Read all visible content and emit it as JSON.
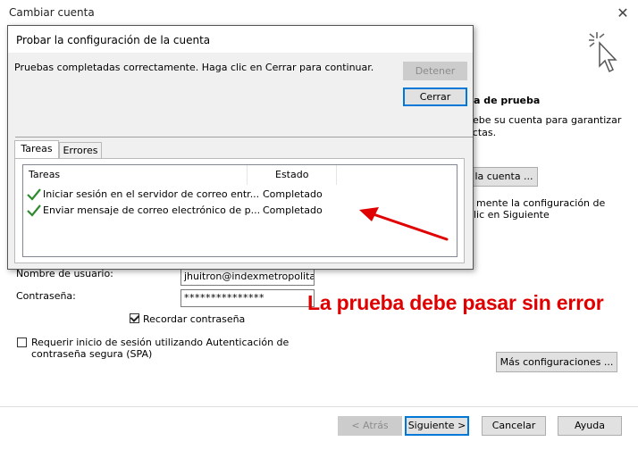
{
  "window": {
    "title": "Cambiar cuenta",
    "close_glyph": "✕"
  },
  "right_partial": {
    "heading": "a de prueba",
    "line1": "uebe su cuenta para garantizar",
    "line2": "ectas.",
    "test_button": "la cuenta ...",
    "line3": "mente la configuración de",
    "line4": "lic en Siguiente"
  },
  "form": {
    "username_label": "Nombre de usuario:",
    "username_value": "jhuitron@indexmetropolitan",
    "password_label": "Contraseña:",
    "password_value": "***************",
    "remember_label": "Recordar contraseña",
    "spa_label_line1": "Requerir inicio de sesión utilizando Autenticación de",
    "spa_label_line2": "contraseña segura (SPA)",
    "more_settings": "Más configuraciones ..."
  },
  "footer": {
    "back": "< Atrás",
    "next": "Siguiente >",
    "cancel": "Cancelar",
    "help": "Ayuda"
  },
  "dialog": {
    "title": "Probar la configuración de la cuenta",
    "message": "Pruebas completadas correctamente. Haga clic en Cerrar para continuar.",
    "stop": "Detener",
    "close": "Cerrar",
    "tabs": [
      "Tareas",
      "Errores"
    ],
    "columns": [
      "Tareas",
      "Estado"
    ],
    "rows": [
      {
        "task": "Iniciar sesión en el servidor de correo entr...",
        "status": "Completado"
      },
      {
        "task": "Enviar mensaje de correo electrónico de p...",
        "status": "Completado"
      }
    ]
  },
  "annotation": {
    "text": "La prueba debe pasar sin error",
    "color": "#e00000"
  },
  "icons": {
    "cursor": "click-cursor-icon",
    "check": "green-check-icon",
    "arrow": "red-arrow"
  },
  "colors": {
    "accent": "#0078d7",
    "check": "#2e8b2e"
  }
}
